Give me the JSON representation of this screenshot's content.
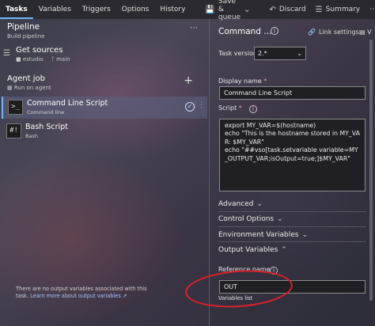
{
  "topbar": {
    "tabs": [
      "Tasks",
      "Variables",
      "Triggers",
      "Options",
      "History"
    ],
    "save_label": "Save & queue",
    "discard_label": "Discard",
    "summary_label": "Summary",
    "more_label": "⋯"
  },
  "pipeline": {
    "title": "Pipeline",
    "subtitle": "Build pipeline",
    "more": "⋯"
  },
  "get_sources": {
    "title": "Get sources",
    "repo": "estudio",
    "branch": "main"
  },
  "agent_job": {
    "title": "Agent job",
    "subtitle": "Run on agent",
    "add": "+"
  },
  "tasks": [
    {
      "title": "Command Line Script",
      "subtitle": "Command line",
      "icon": ">_"
    },
    {
      "title": "Bash Script",
      "subtitle": "Bash",
      "icon": "#!"
    }
  ],
  "panel": {
    "title": "Command ...",
    "link_settings": "Link settings",
    "view_label": "V",
    "task_version_label": "Task version",
    "task_version_value": "2.*",
    "display_name_label": "Display name",
    "display_name_value": "Command Line Script",
    "script_label": "Script",
    "script_value": "export MY_VAR=$(hostname)\necho \"This is the hostname stored in MY_VAR: $MY_VAR\"\necho \"##vso[task.setvariable variable=MY_OUTPUT_VAR;isOutput=true;]$MY_VAR\"",
    "sections": [
      "Advanced",
      "Control Options",
      "Environment Variables",
      "Output Variables"
    ],
    "reference_name_label": "Reference name",
    "reference_name_value": "OUT",
    "variables_list_label": "Variables list",
    "note_text": "There are no output variables associated with this task.",
    "note_link": "Learn more about output variables"
  },
  "colors": {
    "accent": "#6fb6ff",
    "annotation": "#e0202a"
  }
}
